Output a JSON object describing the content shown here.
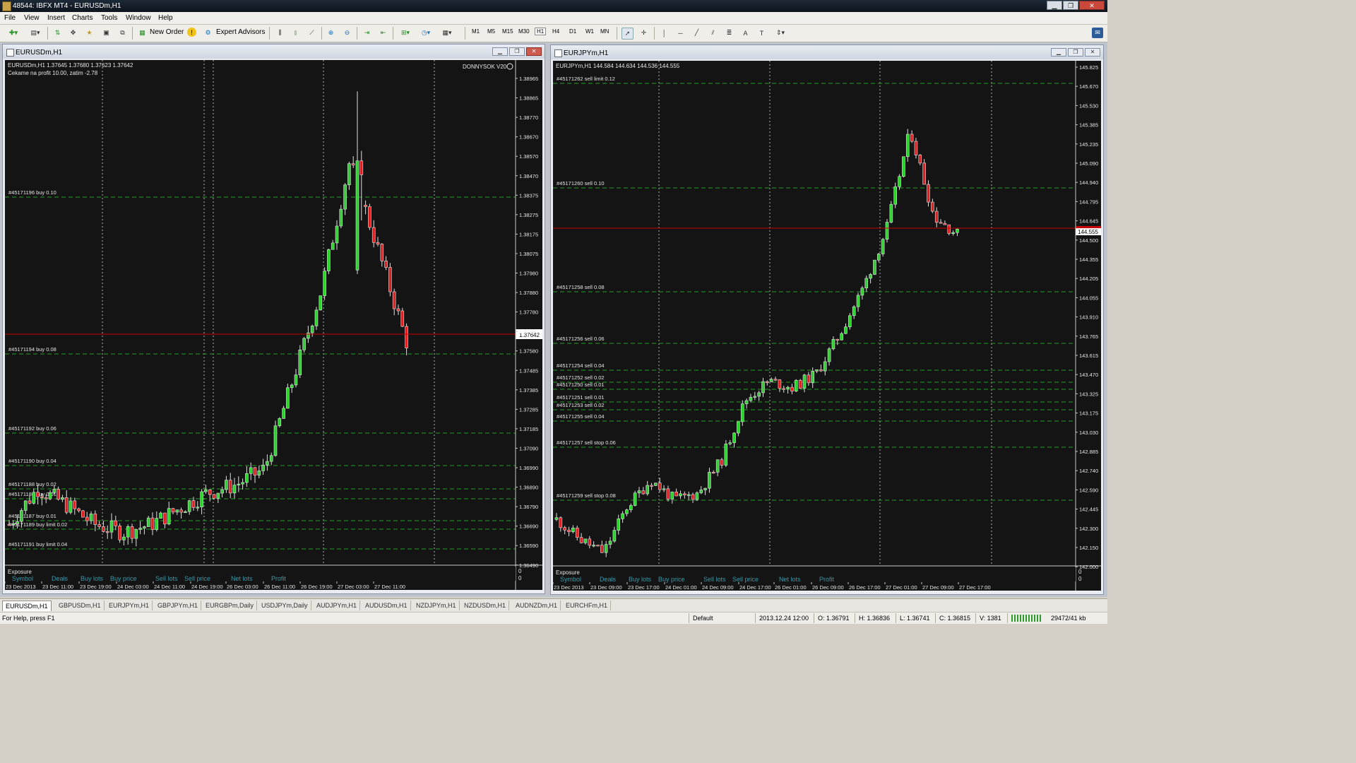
{
  "window": {
    "title": "48544: IBFX MT4 - EURUSDm,H1"
  },
  "menu": [
    "File",
    "View",
    "Insert",
    "Charts",
    "Tools",
    "Window",
    "Help"
  ],
  "toolbar": {
    "new_order": "New Order",
    "expert_advisors": "Expert Advisors",
    "timeframes": [
      "M1",
      "M5",
      "M15",
      "M30",
      "H1",
      "H4",
      "D1",
      "W1",
      "MN"
    ]
  },
  "chart1": {
    "title": "EURUSDm,H1",
    "info_line": "EURUSDm,H1  1.37645 1.37680 1.37623 1.37642",
    "comment": "Cekame na profit 10.00, zatim -2.78",
    "ea_name": "DONNYSOK V20",
    "current_price_label": "1.37642",
    "price_axis": [
      "1.38965",
      "1.38865",
      "1.38770",
      "1.38670",
      "1.38570",
      "1.38470",
      "1.38375",
      "1.38275",
      "1.38175",
      "1.38075",
      "1.37980",
      "1.37880",
      "1.37780",
      "1.37680",
      "1.37580",
      "1.37485",
      "1.37385",
      "1.37285",
      "1.37185",
      "1.37090",
      "1.36990",
      "1.36890",
      "1.36790",
      "1.36690",
      "1.36590",
      "1.36490"
    ],
    "orders": [
      "#45171196 buy 0.10",
      "#45171194 buy 0.08",
      "#45171192 buy 0.06",
      "#45171190 buy 0.04",
      "#45171188 buy 0.02",
      "#45171186 buy 0.01",
      "#45171187 buy 0.01",
      "#45171189 buy limit 0.02",
      "#45171191 buy limit 0.04"
    ],
    "time_axis": [
      "23 Dec 2013",
      "23 Dec 11:00",
      "23 Dec 19:00",
      "24 Dec 03:00",
      "24 Dec 11:00",
      "24 Dec 19:00",
      "26 Dec 03:00",
      "26 Dec 11:00",
      "26 Dec 19:00",
      "27 Dec 03:00",
      "27 Dec 11:00"
    ],
    "exposure": {
      "label": "Exposure",
      "columns": [
        "Symbol",
        "Deals",
        "Buy lots",
        "Buy price",
        "Sell lots",
        "Sell price",
        "Net lots",
        "Profit"
      ],
      "scale": [
        "0",
        "0"
      ]
    }
  },
  "chart2": {
    "title": "EURJPYm,H1",
    "info_line": "EURJPYm,H1  144.584 144.634 144.536 144.555",
    "current_price_label": "144.555",
    "price_axis": [
      "145.825",
      "145.670",
      "145.530",
      "145.385",
      "145.235",
      "145.090",
      "144.940",
      "144.795",
      "144.645",
      "144.500",
      "144.355",
      "144.205",
      "144.055",
      "143.910",
      "143.765",
      "143.615",
      "143.470",
      "143.325",
      "143.175",
      "143.030",
      "142.885",
      "142.740",
      "142.590",
      "142.445",
      "142.300",
      "142.150",
      "142.000"
    ],
    "orders": [
      "#45171262 sell limit 0.12",
      "#45171260 sell 0.10",
      "#45171258 sell 0.08",
      "#45171256 sell 0.06",
      "#45171254 sell 0.04",
      "#45171252 sell 0.02",
      "#45171250 sell 0.01",
      "#45171251 sell 0.01",
      "#45171253 sell 0.02",
      "#45171255 sell 0.04",
      "#45171257 sell stop 0.06",
      "#45171259 sell stop 0.08"
    ],
    "time_axis": [
      "23 Dec 2013",
      "23 Dec 09:00",
      "23 Dec 17:00",
      "24 Dec 01:00",
      "24 Dec 09:00",
      "24 Dec 17:00",
      "26 Dec 01:00",
      "26 Dec 09:00",
      "26 Dec 17:00",
      "27 Dec 01:00",
      "27 Dec 09:00",
      "27 Dec 17:00"
    ],
    "exposure": {
      "label": "Exposure",
      "columns": [
        "Symbol",
        "Deals",
        "Buy lots",
        "Buy price",
        "Sell lots",
        "Sell price",
        "Net lots",
        "Profit"
      ],
      "scale": [
        "0",
        "0"
      ]
    }
  },
  "tabs": [
    "EURUSDm,H1",
    "GBPUSDm,H1",
    "EURJPYm,H1",
    "GBPJPYm,H1",
    "EURGBPm,Daily",
    "USDJPYm,Daily",
    "AUDJPYm,H1",
    "AUDUSDm,H1",
    "NZDJPYm,H1",
    "NZDUSDm,H1",
    "AUDNZDm,H1",
    "EURCHFm,H1"
  ],
  "status": {
    "help": "For Help, press F1",
    "profile": "Default",
    "time": "2013.12.24 12:00",
    "open": "O: 1.36791",
    "high": "H: 1.36836",
    "low": "L: 1.36741",
    "close": "C: 1.36815",
    "volume": "V: 1381",
    "traffic": "29472/41 kb"
  },
  "colors": {
    "chart_bg": "#141414",
    "bull": "#2bd42b",
    "bear": "#e02020",
    "grid": "#d8d8d8",
    "order_line": "#1fa01f",
    "price_line": "#cc0000"
  }
}
